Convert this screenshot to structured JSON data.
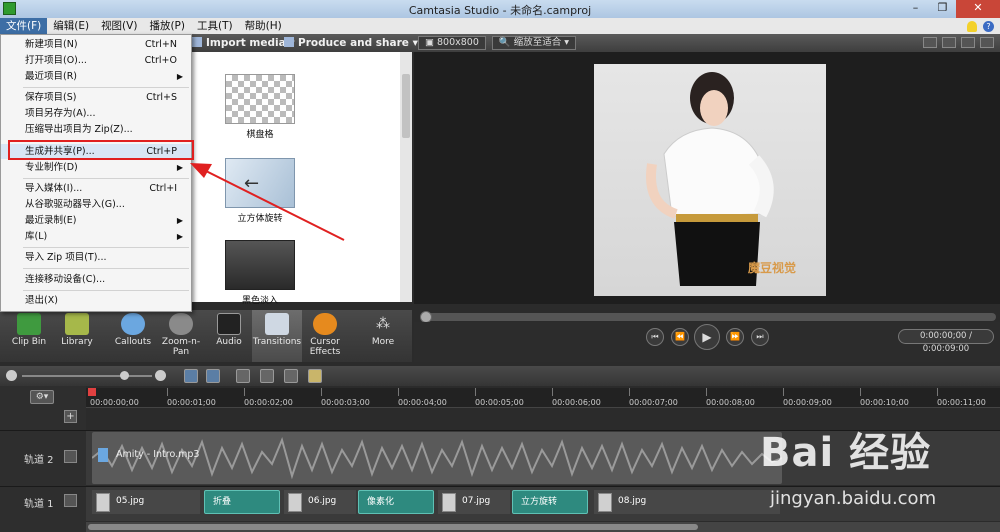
{
  "window": {
    "title": "Camtasia Studio - 未命名.camproj"
  },
  "menubar": {
    "items": [
      "文件(F)",
      "编辑(E)",
      "视图(V)",
      "播放(P)",
      "工具(T)",
      "帮助(H)"
    ]
  },
  "toolbar": {
    "import_media": "Import media",
    "produce_share": "Produce and share",
    "dimension": "800x800",
    "zoom_fit": "缩放至适合"
  },
  "file_menu": {
    "items": [
      {
        "label": "新建项目(N)",
        "shortcut": "Ctrl+N"
      },
      {
        "label": "打开项目(O)...",
        "shortcut": "Ctrl+O"
      },
      {
        "label": "最近项目(R)",
        "shortcut": ""
      },
      {
        "label": "保存项目(S)",
        "shortcut": "Ctrl+S"
      },
      {
        "label": "项目另存为(A)...",
        "shortcut": ""
      },
      {
        "label": "压缩导出项目为 Zip(Z)...",
        "shortcut": ""
      },
      {
        "label": "生成并共享(P)...",
        "shortcut": "Ctrl+P"
      },
      {
        "label": "专业制作(D)",
        "shortcut": ""
      },
      {
        "label": "导入媒体(I)...",
        "shortcut": "Ctrl+I"
      },
      {
        "label": "从谷歌驱动器导入(G)...",
        "shortcut": ""
      },
      {
        "label": "最近录制(E)",
        "shortcut": ""
      },
      {
        "label": "库(L)",
        "shortcut": ""
      },
      {
        "label": "导入 Zip 项目(T)...",
        "shortcut": ""
      },
      {
        "label": "连接移动设备(C)...",
        "shortcut": ""
      },
      {
        "label": "退出(X)",
        "shortcut": ""
      }
    ]
  },
  "transitions": {
    "tiles": [
      "棋盘格",
      "立方体旋转",
      "黑色淡入"
    ]
  },
  "tabs": [
    "Clip Bin",
    "Library",
    "Callouts",
    "Zoom-n-Pan",
    "Audio",
    "Transitions",
    "Cursor Effects",
    "More"
  ],
  "player": {
    "time": "0:00:00;00 / 0:00:09:00"
  },
  "preview": {
    "watermark": "魔豆视觉"
  },
  "timeline": {
    "ruler": [
      "00:00:00;00",
      "00:00:01;00",
      "00:00:02;00",
      "00:00:03;00",
      "00:00:04;00",
      "00:00:05;00",
      "00:00:06;00",
      "00:00:07;00",
      "00:00:08;00",
      "00:00:09;00",
      "00:00:10;00",
      "00:00:11;00"
    ],
    "track2": {
      "name": "轨道 2",
      "audio_clip": "Amity - Intro.mp3"
    },
    "track1": {
      "name": "轨道 1",
      "clips": [
        "05.jpg",
        "折叠",
        "06.jpg",
        "像素化",
        "07.jpg",
        "立方旋转",
        "08.jpg"
      ]
    }
  },
  "watermark": {
    "baidu": "Bai 经验",
    "url": "jingyan.baidu.com"
  },
  "colors": {
    "highlight_box": "#e02020",
    "transition_clip": "#2e8a7f",
    "menu_active": "#3d6ea5"
  }
}
